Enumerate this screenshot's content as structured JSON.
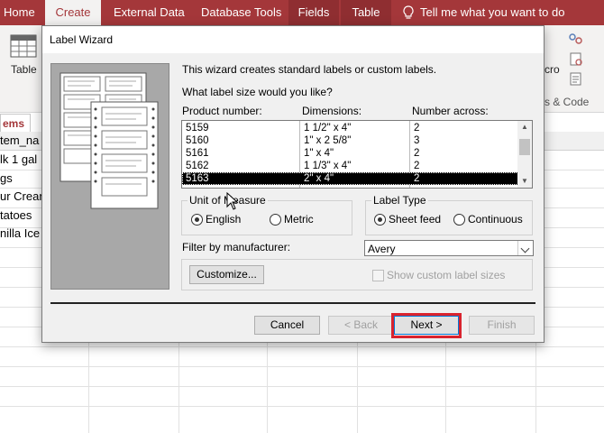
{
  "ribbon": {
    "tabs": [
      {
        "label": "Home"
      },
      {
        "label": "Create"
      },
      {
        "label": "External Data"
      },
      {
        "label": "Database Tools"
      },
      {
        "label": "Fields"
      },
      {
        "label": "Table"
      }
    ],
    "tell_me": "Tell me what you want to do",
    "table_button": "Table",
    "macro_label": "cro",
    "group_label": "s & Code"
  },
  "sheet": {
    "doc_tab": "ems",
    "header": "tem_na",
    "rows": [
      "lk 1 gal",
      "gs",
      "ur Crean",
      "tatoes",
      "nilla Ice"
    ]
  },
  "dialog": {
    "title": "Label Wizard",
    "intro": "This wizard creates standard labels or custom labels.",
    "question": "What label size would you like?",
    "col_product": "Product number:",
    "col_dimensions": "Dimensions:",
    "col_number": "Number across:",
    "rows": [
      {
        "product": "5159",
        "dimensions": "1 1/2\" x 4\"",
        "number": "2"
      },
      {
        "product": "5160",
        "dimensions": "1\" x 2 5/8\"",
        "number": "3"
      },
      {
        "product": "5161",
        "dimensions": "1\" x 4\"",
        "number": "2"
      },
      {
        "product": "5162",
        "dimensions": "1 1/3\" x 4\"",
        "number": "2"
      },
      {
        "product": "5163",
        "dimensions": "2\" x 4\"",
        "number": "2"
      }
    ],
    "unit_group": "Unit of Measure",
    "unit_english": "English",
    "unit_metric": "Metric",
    "label_type_group": "Label Type",
    "type_sheet": "Sheet feed",
    "type_continuous": "Continuous",
    "filter_label": "Filter by  manufacturer:",
    "filter_value": "Avery",
    "customize": "Customize...",
    "show_custom": "Show custom label sizes",
    "cancel": "Cancel",
    "back": "< Back",
    "next": "Next >",
    "finish": "Finish"
  }
}
